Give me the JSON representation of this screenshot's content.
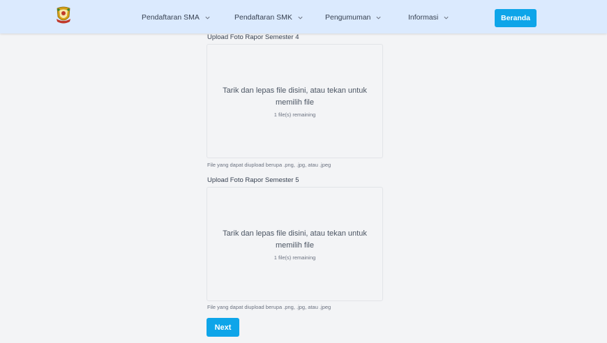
{
  "nav": {
    "items": [
      {
        "label": "Pendaftaran SMA"
      },
      {
        "label": "Pendaftaran SMK"
      },
      {
        "label": "Pengumuman"
      },
      {
        "label": "Informasi"
      }
    ],
    "home_button": "Beranda"
  },
  "uploads": [
    {
      "label": "Upload Foto Rapor Semester 4",
      "dropzone_text": "Tarik dan lepas file disini, atau tekan untuk memilih file",
      "remaining": "1 file(s) remaining",
      "hint": "File yang dapat diupload berupa .png, .jpg, atau .jpeg"
    },
    {
      "label": "Upload Foto Rapor Semester 5",
      "dropzone_text": "Tarik dan lepas file disini, atau tekan untuk memilih file",
      "remaining": "1 file(s) remaining",
      "hint": "File yang dapat diupload berupa .png, .jpg, atau .jpeg"
    }
  ],
  "next_button": "Next",
  "colors": {
    "accent": "#0ea5e9",
    "navbar_bg": "#dbeafe",
    "page_bg": "#f3f4f6"
  },
  "icons": {
    "logo": "provincial-emblem-icon",
    "nav_dropdown": "chevron-down-icon"
  }
}
